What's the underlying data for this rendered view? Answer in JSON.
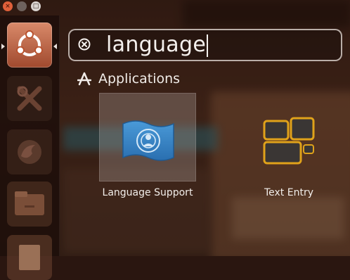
{
  "search": {
    "query": "language"
  },
  "category": {
    "label": "Applications"
  },
  "results": [
    {
      "label": "Language Support",
      "icon": "language-support-icon"
    },
    {
      "label": "Text Entry",
      "icon": "text-entry-icon"
    }
  ],
  "launcher": {
    "items": [
      "dash-home",
      "tools",
      "firefox",
      "files",
      "document"
    ]
  },
  "colors": {
    "accent": "#dd4814",
    "highlight": "#c8beb9",
    "text": "#f2eeea"
  }
}
